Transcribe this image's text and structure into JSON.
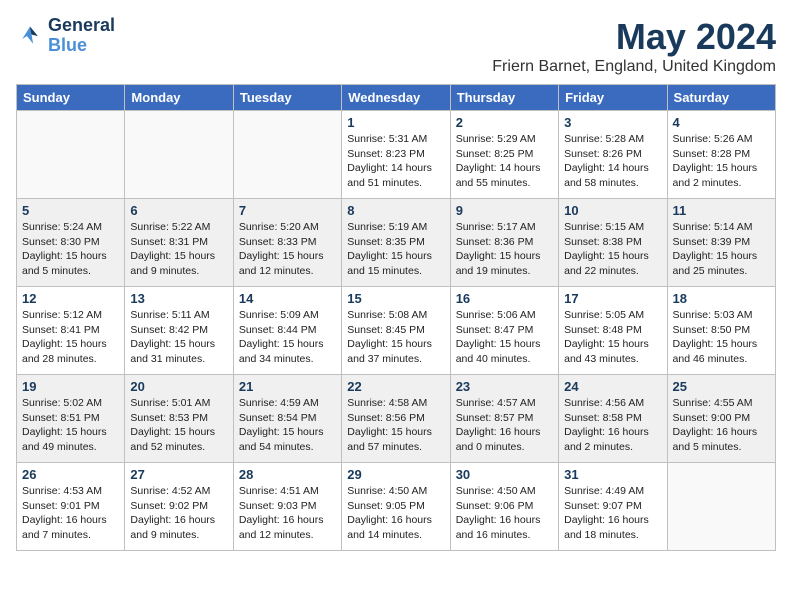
{
  "header": {
    "logo_line1": "General",
    "logo_line2": "Blue",
    "month": "May 2024",
    "location": "Friern Barnet, England, United Kingdom"
  },
  "days_of_week": [
    "Sunday",
    "Monday",
    "Tuesday",
    "Wednesday",
    "Thursday",
    "Friday",
    "Saturday"
  ],
  "weeks": [
    [
      {
        "day": "",
        "text": ""
      },
      {
        "day": "",
        "text": ""
      },
      {
        "day": "",
        "text": ""
      },
      {
        "day": "1",
        "text": "Sunrise: 5:31 AM\nSunset: 8:23 PM\nDaylight: 14 hours\nand 51 minutes."
      },
      {
        "day": "2",
        "text": "Sunrise: 5:29 AM\nSunset: 8:25 PM\nDaylight: 14 hours\nand 55 minutes."
      },
      {
        "day": "3",
        "text": "Sunrise: 5:28 AM\nSunset: 8:26 PM\nDaylight: 14 hours\nand 58 minutes."
      },
      {
        "day": "4",
        "text": "Sunrise: 5:26 AM\nSunset: 8:28 PM\nDaylight: 15 hours\nand 2 minutes."
      }
    ],
    [
      {
        "day": "5",
        "text": "Sunrise: 5:24 AM\nSunset: 8:30 PM\nDaylight: 15 hours\nand 5 minutes."
      },
      {
        "day": "6",
        "text": "Sunrise: 5:22 AM\nSunset: 8:31 PM\nDaylight: 15 hours\nand 9 minutes."
      },
      {
        "day": "7",
        "text": "Sunrise: 5:20 AM\nSunset: 8:33 PM\nDaylight: 15 hours\nand 12 minutes."
      },
      {
        "day": "8",
        "text": "Sunrise: 5:19 AM\nSunset: 8:35 PM\nDaylight: 15 hours\nand 15 minutes."
      },
      {
        "day": "9",
        "text": "Sunrise: 5:17 AM\nSunset: 8:36 PM\nDaylight: 15 hours\nand 19 minutes."
      },
      {
        "day": "10",
        "text": "Sunrise: 5:15 AM\nSunset: 8:38 PM\nDaylight: 15 hours\nand 22 minutes."
      },
      {
        "day": "11",
        "text": "Sunrise: 5:14 AM\nSunset: 8:39 PM\nDaylight: 15 hours\nand 25 minutes."
      }
    ],
    [
      {
        "day": "12",
        "text": "Sunrise: 5:12 AM\nSunset: 8:41 PM\nDaylight: 15 hours\nand 28 minutes."
      },
      {
        "day": "13",
        "text": "Sunrise: 5:11 AM\nSunset: 8:42 PM\nDaylight: 15 hours\nand 31 minutes."
      },
      {
        "day": "14",
        "text": "Sunrise: 5:09 AM\nSunset: 8:44 PM\nDaylight: 15 hours\nand 34 minutes."
      },
      {
        "day": "15",
        "text": "Sunrise: 5:08 AM\nSunset: 8:45 PM\nDaylight: 15 hours\nand 37 minutes."
      },
      {
        "day": "16",
        "text": "Sunrise: 5:06 AM\nSunset: 8:47 PM\nDaylight: 15 hours\nand 40 minutes."
      },
      {
        "day": "17",
        "text": "Sunrise: 5:05 AM\nSunset: 8:48 PM\nDaylight: 15 hours\nand 43 minutes."
      },
      {
        "day": "18",
        "text": "Sunrise: 5:03 AM\nSunset: 8:50 PM\nDaylight: 15 hours\nand 46 minutes."
      }
    ],
    [
      {
        "day": "19",
        "text": "Sunrise: 5:02 AM\nSunset: 8:51 PM\nDaylight: 15 hours\nand 49 minutes."
      },
      {
        "day": "20",
        "text": "Sunrise: 5:01 AM\nSunset: 8:53 PM\nDaylight: 15 hours\nand 52 minutes."
      },
      {
        "day": "21",
        "text": "Sunrise: 4:59 AM\nSunset: 8:54 PM\nDaylight: 15 hours\nand 54 minutes."
      },
      {
        "day": "22",
        "text": "Sunrise: 4:58 AM\nSunset: 8:56 PM\nDaylight: 15 hours\nand 57 minutes."
      },
      {
        "day": "23",
        "text": "Sunrise: 4:57 AM\nSunset: 8:57 PM\nDaylight: 16 hours\nand 0 minutes."
      },
      {
        "day": "24",
        "text": "Sunrise: 4:56 AM\nSunset: 8:58 PM\nDaylight: 16 hours\nand 2 minutes."
      },
      {
        "day": "25",
        "text": "Sunrise: 4:55 AM\nSunset: 9:00 PM\nDaylight: 16 hours\nand 5 minutes."
      }
    ],
    [
      {
        "day": "26",
        "text": "Sunrise: 4:53 AM\nSunset: 9:01 PM\nDaylight: 16 hours\nand 7 minutes."
      },
      {
        "day": "27",
        "text": "Sunrise: 4:52 AM\nSunset: 9:02 PM\nDaylight: 16 hours\nand 9 minutes."
      },
      {
        "day": "28",
        "text": "Sunrise: 4:51 AM\nSunset: 9:03 PM\nDaylight: 16 hours\nand 12 minutes."
      },
      {
        "day": "29",
        "text": "Sunrise: 4:50 AM\nSunset: 9:05 PM\nDaylight: 16 hours\nand 14 minutes."
      },
      {
        "day": "30",
        "text": "Sunrise: 4:50 AM\nSunset: 9:06 PM\nDaylight: 16 hours\nand 16 minutes."
      },
      {
        "day": "31",
        "text": "Sunrise: 4:49 AM\nSunset: 9:07 PM\nDaylight: 16 hours\nand 18 minutes."
      },
      {
        "day": "",
        "text": ""
      }
    ]
  ]
}
